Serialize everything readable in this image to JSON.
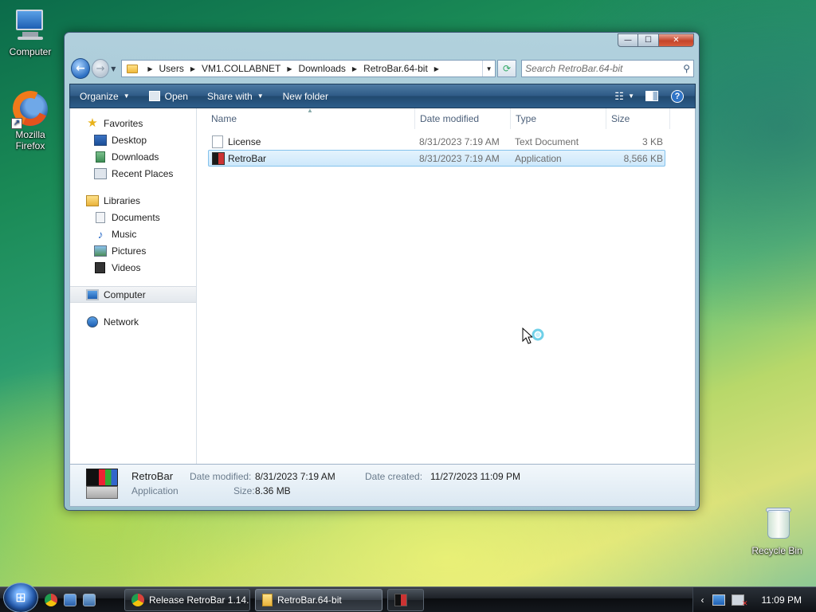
{
  "desktop": {
    "icons": [
      {
        "label": "Computer"
      },
      {
        "label": "Mozilla Firefox"
      },
      {
        "label": "Recycle Bin"
      }
    ]
  },
  "window": {
    "caption_buttons": {
      "minimize": "—",
      "maximize": "☐",
      "close": "✕"
    },
    "breadcrumbs": [
      "Users",
      "VM1.COLLABNET",
      "Downloads",
      "RetroBar.64-bit"
    ],
    "search_placeholder": "Search RetroBar.64-bit",
    "toolbar": {
      "organize": "Organize",
      "open": "Open",
      "share_with": "Share with",
      "new_folder": "New folder"
    },
    "nav": {
      "favorites": "Favorites",
      "favorites_items": [
        "Desktop",
        "Downloads",
        "Recent Places"
      ],
      "libraries": "Libraries",
      "libraries_items": [
        "Documents",
        "Music",
        "Pictures",
        "Videos"
      ],
      "computer": "Computer",
      "network": "Network"
    },
    "columns": {
      "name": "Name",
      "date": "Date modified",
      "type": "Type",
      "size": "Size"
    },
    "files": [
      {
        "name": "License",
        "date": "8/31/2023 7:19 AM",
        "type": "Text Document",
        "size": "3 KB",
        "icon": "text-file-icon"
      },
      {
        "name": "RetroBar",
        "date": "8/31/2023 7:19 AM",
        "type": "Application",
        "size": "8,566 KB",
        "icon": "application-icon"
      }
    ],
    "details": {
      "name": "RetroBar",
      "kind": "Application",
      "date_modified_label": "Date modified:",
      "date_modified": "8/31/2023 7:19 AM",
      "size_label": "Size:",
      "size": "8.36 MB",
      "date_created_label": "Date created:",
      "date_created": "11/27/2023 11:09 PM"
    }
  },
  "taskbar": {
    "buttons": [
      {
        "label": "Release RetroBar 1.14..."
      },
      {
        "label": "RetroBar.64-bit"
      }
    ],
    "clock": "11:09 PM"
  }
}
